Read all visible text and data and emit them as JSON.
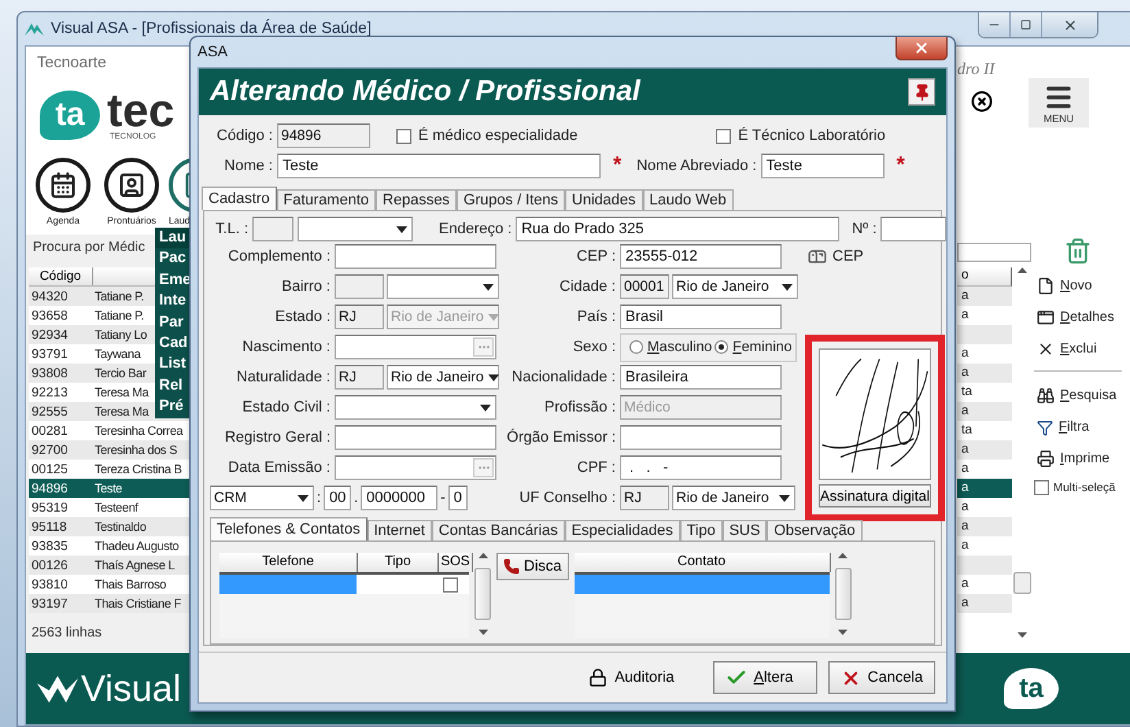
{
  "main_window": {
    "title": "Visual ASA - [Profissionais da Área de Saúde]"
  },
  "sidebar": {
    "company": "Tecnoarte",
    "logo_mark": "ta",
    "logo_name": "tec",
    "logo_tagline": "TECNOLOG",
    "shortcuts": [
      {
        "label": "Agenda",
        "kind": "calendar"
      },
      {
        "label": "Prontuários",
        "kind": "record"
      },
      {
        "label": "Laud",
        "kind": "report"
      }
    ],
    "search_label": "Procura por Médic"
  },
  "popup_menu": [
    {
      "label": "Lau",
      "selected": true
    },
    {
      "label": "Pac",
      "selected": false
    },
    {
      "label": "Eme",
      "selected": false
    },
    {
      "label": "Inte",
      "selected": false
    },
    {
      "label": "Par",
      "selected": false
    },
    {
      "label": "Cad",
      "selected": false
    },
    {
      "label": "List",
      "selected": false
    },
    {
      "label": "Rel",
      "selected": false
    },
    {
      "label": "Pré",
      "selected": false
    }
  ],
  "table": {
    "columns": [
      "Código"
    ],
    "column_3_header": "o",
    "rows": [
      {
        "code": "94320",
        "name": "Tatiane P.",
        "column_3": "a",
        "selected": false
      },
      {
        "code": "93658",
        "name": "Tatiane P.",
        "column_3": "a",
        "selected": false
      },
      {
        "code": "92934",
        "name": "Tatiany Lo",
        "selected": false
      },
      {
        "code": "93791",
        "name": "Taywana",
        "column_3": "a",
        "selected": false
      },
      {
        "code": "93808",
        "name": "Tercio Bar",
        "column_3": "a",
        "selected": false
      },
      {
        "code": "92213",
        "name": "Teresa Ma",
        "column_3": "ta",
        "selected": false
      },
      {
        "code": "92555",
        "name": "Teresa Ma",
        "column_3": "a",
        "selected": false
      },
      {
        "code": "00281",
        "name": "Teresinha Correa",
        "column_3": "ta",
        "selected": false
      },
      {
        "code": "92700",
        "name": "Teresinha dos S",
        "column_3": "a",
        "selected": false
      },
      {
        "code": "00125",
        "name": "Tereza Cristina B",
        "column_3": "a",
        "selected": false
      },
      {
        "code": "94896",
        "name": "Teste",
        "column_3": "a",
        "selected": true
      },
      {
        "code": "95319",
        "name": "Testeenf",
        "column_3": "a",
        "selected": false
      },
      {
        "code": "95118",
        "name": "Testinaldo",
        "column_3": "a",
        "selected": false
      },
      {
        "code": "93835",
        "name": "Thadeu Augusto",
        "column_3": "a",
        "selected": false
      },
      {
        "code": "00126",
        "name": "Thaís Agnese L",
        "selected": false
      },
      {
        "code": "93810",
        "name": "Thais Barroso",
        "column_3": "a",
        "selected": false
      },
      {
        "code": "93197",
        "name": "Thais Cristiane F",
        "column_3": "a",
        "selected": false
      }
    ]
  },
  "row_count": "2563 linhas",
  "top_right": {
    "unit": "dro II",
    "menu_label": "MENU"
  },
  "actions": [
    {
      "kind": "new",
      "label": "Novo"
    },
    {
      "kind": "details",
      "label": "Detalhes"
    },
    {
      "kind": "delete",
      "label": "Exclui"
    },
    {
      "kind": "separator"
    },
    {
      "kind": "search",
      "label": "Pesquisa"
    },
    {
      "kind": "filter",
      "label": "Filtra"
    },
    {
      "kind": "print",
      "label": "Imprime"
    },
    {
      "kind": "checkbox",
      "label": "Multi-seleçã",
      "checked": false
    }
  ],
  "brand": {
    "name": "Visual",
    "mark": "ta"
  },
  "dialog": {
    "title": "ASA",
    "heading": "Alterando Médico / Profissional",
    "code_label": "Código :",
    "code": "94896",
    "flags": [
      {
        "label": "É médico especialidade",
        "checked": false
      },
      {
        "label": "É Técnico Laboratório",
        "checked": false
      }
    ],
    "name_label": "Nome :",
    "name": "Teste",
    "name_required": "*",
    "short_name_label": "Nome Abreviado :",
    "short_name": "Teste",
    "short_name_required": "*",
    "tabs": [
      {
        "label": "Cadastro",
        "selected": true
      },
      {
        "label": "Faturamento",
        "selected": false
      },
      {
        "label": "Repasses",
        "selected": false
      },
      {
        "label": "Grupos / Itens",
        "selected": false
      },
      {
        "label": "Unidades",
        "selected": false
      },
      {
        "label": "Laudo Web",
        "selected": false
      }
    ],
    "form": {
      "tl_label": "T.L. :",
      "address_label": "Endereço :",
      "address": "Rua do Prado 325",
      "number_label": "Nº :",
      "rows": [
        {
          "left": {
            "label": "Complemento :",
            "kind": "text",
            "disabled": false
          },
          "right": {
            "label": "CEP :",
            "kind": "text",
            "value": "23555-012",
            "disabled": false
          }
        },
        {
          "left": {
            "label": "Bairro :",
            "kind": "code_combo",
            "disabled": false
          },
          "right": {
            "label": "Cidade :",
            "kind": "code_combo",
            "code": "00001",
            "value": "Rio de Janeiro",
            "disabled": false
          }
        },
        {
          "left": {
            "label": "Estado :",
            "kind": "code_combo",
            "code": "RJ",
            "value": "Rio de Janeiro",
            "disabled": true
          },
          "right": {
            "label": "País :",
            "kind": "text",
            "value": "Brasil",
            "disabled": false
          }
        },
        {
          "left": {
            "label": "Nascimento :",
            "kind": "date",
            "disabled": false
          },
          "right": {
            "label": "Sexo :",
            "kind": "radio",
            "disabled": false,
            "options": [
              {
                "label": "Masculino",
                "selected": false
              },
              {
                "label": "Feminino",
                "selected": true
              }
            ]
          }
        },
        {
          "left": {
            "label": "Naturalidade :",
            "kind": "code_combo",
            "code": "RJ",
            "value": "Rio de Janeiro",
            "disabled": false
          },
          "right": {
            "label": "Nacionalidade :",
            "kind": "text",
            "value": "Brasileira",
            "disabled": false
          }
        },
        {
          "left": {
            "label": "Estado Civil :",
            "kind": "combo",
            "disabled": false
          },
          "right": {
            "label": "Profissão :",
            "kind": "text",
            "value": "Médico",
            "disabled": true
          }
        },
        {
          "left": {
            "label": "Registro Geral :",
            "kind": "text",
            "disabled": false
          },
          "right": {
            "label": "Órgão Emissor :",
            "kind": "text",
            "disabled": false
          }
        },
        {
          "left": {
            "label": "Data Emissão :",
            "kind": "date",
            "disabled": false
          },
          "right": {
            "label": "CPF :",
            "kind": "text",
            "value": " .   .   -",
            "disabled": false
          }
        }
      ],
      "council": {
        "type": "CRM",
        "colon": ":",
        "region": "00",
        "dot": ".",
        "number": "0000000",
        "dash": "-",
        "digit": "0",
        "uf_label": "UF Conselho :",
        "uf": "RJ",
        "uf_name": "Rio de Janeiro"
      },
      "cep_button": "CEP",
      "signature_button": "Assinatura digital"
    },
    "subtabs": [
      {
        "label": "Telefones & Contatos",
        "selected": true
      },
      {
        "label": "Internet",
        "selected": false
      },
      {
        "label": "Contas Bancárias",
        "selected": false
      },
      {
        "label": "Especialidades",
        "selected": false
      },
      {
        "label": "Tipo",
        "selected": false
      },
      {
        "label": "SUS",
        "selected": false
      },
      {
        "label": "Observação",
        "selected": false
      }
    ],
    "phones": {
      "columns": [
        "Telefone",
        "Tipo",
        "SOS"
      ],
      "rows": [
        {
          "selected": true,
          "sos_checked": false
        }
      ]
    },
    "dial_button": "Disca",
    "contacts": {
      "columns": [
        "Contato"
      ],
      "rows": [
        {
          "selected": true
        }
      ]
    },
    "buttons": [
      {
        "kind": "audit",
        "label": "Auditoria"
      },
      {
        "kind": "confirm",
        "label": "Altera"
      },
      {
        "kind": "cancel",
        "label": "Cancela"
      }
    ]
  }
}
